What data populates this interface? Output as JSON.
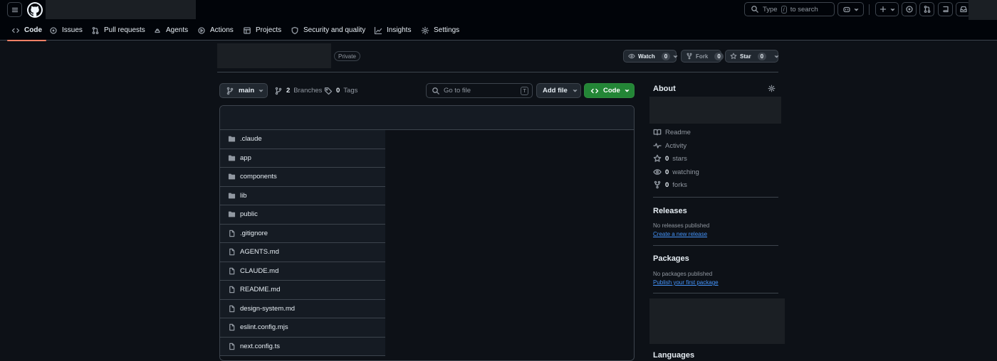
{
  "header": {
    "search_text_before": "Type",
    "search_key": "/",
    "search_text_after": "to search"
  },
  "tabs": [
    {
      "label": "Code",
      "active": true,
      "icon": "code-icon"
    },
    {
      "label": "Issues",
      "icon": "issue-icon"
    },
    {
      "label": "Pull requests",
      "icon": "pull-request-icon"
    },
    {
      "label": "Agents",
      "icon": "agents-icon"
    },
    {
      "label": "Actions",
      "icon": "play-icon"
    },
    {
      "label": "Projects",
      "icon": "table-icon"
    },
    {
      "label": "Security and quality",
      "icon": "shield-icon"
    },
    {
      "label": "Insights",
      "icon": "graph-icon"
    },
    {
      "label": "Settings",
      "icon": "gear-icon"
    }
  ],
  "repo": {
    "visibility": "Private",
    "watch_label": "Watch",
    "watch_count": "0",
    "fork_label": "Fork",
    "fork_count": "0",
    "star_label": "Star",
    "star_count": "0"
  },
  "filenav": {
    "branch": "main",
    "branches_count": "2",
    "branches_label": "Branches",
    "tags_count": "0",
    "tags_label": "Tags",
    "goto_placeholder": "Go to file",
    "goto_key": "T",
    "add_file_label": "Add file",
    "code_label": "Code"
  },
  "files": [
    {
      "name": ".claude",
      "type": "folder"
    },
    {
      "name": "app",
      "type": "folder"
    },
    {
      "name": "components",
      "type": "folder"
    },
    {
      "name": "lib",
      "type": "folder"
    },
    {
      "name": "public",
      "type": "folder"
    },
    {
      "name": ".gitignore",
      "type": "file"
    },
    {
      "name": "AGENTS.md",
      "type": "file"
    },
    {
      "name": "CLAUDE.md",
      "type": "file"
    },
    {
      "name": "README.md",
      "type": "file"
    },
    {
      "name": "design-system.md",
      "type": "file"
    },
    {
      "name": "eslint.config.mjs",
      "type": "file"
    },
    {
      "name": "next.config.ts",
      "type": "file"
    }
  ],
  "sidebar": {
    "about_title": "About",
    "readme": "Readme",
    "activity": "Activity",
    "stars_count": "0",
    "stars_label": "stars",
    "watching_count": "0",
    "watching_label": "watching",
    "forks_count": "0",
    "forks_label": "forks",
    "releases_title": "Releases",
    "releases_note": "No releases published",
    "releases_link": "Create a new release",
    "packages_title": "Packages",
    "packages_note": "No packages published",
    "packages_link": "Publish your first package",
    "languages_title": "Languages"
  },
  "colors": {
    "background": "#0d1117",
    "header_bg": "#010409",
    "border": "#3d444d",
    "accent_tab": "#f78166",
    "primary_button": "#238636",
    "link": "#4493f8",
    "muted_text": "#9198a1"
  }
}
